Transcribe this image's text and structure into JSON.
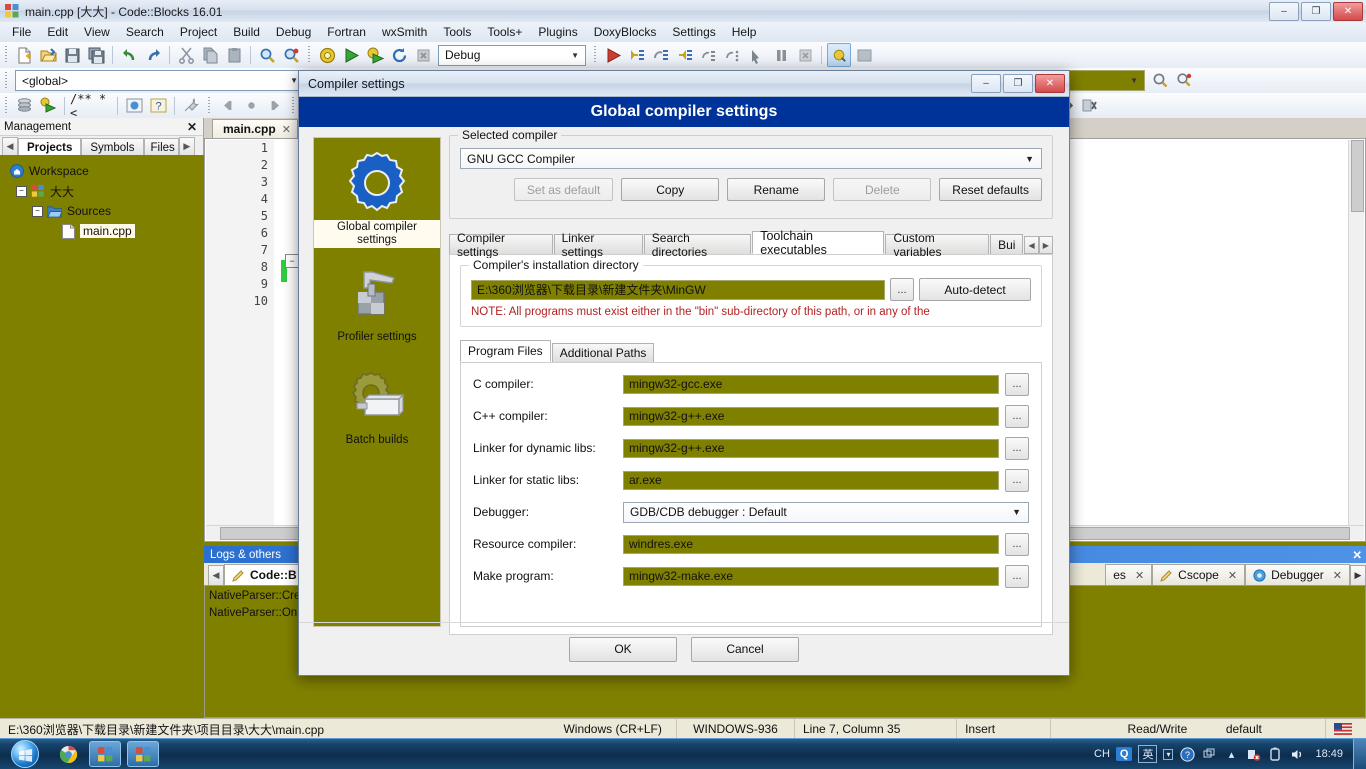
{
  "window": {
    "title": "main.cpp [大大] - Code::Blocks 16.01",
    "minimize": "–",
    "maximize": "❐",
    "close": "✕"
  },
  "menubar": {
    "items": [
      "File",
      "Edit",
      "View",
      "Search",
      "Project",
      "Build",
      "Debug",
      "Fortran",
      "wxSmith",
      "Tools",
      "Tools+",
      "Plugins",
      "DoxyBlocks",
      "Settings",
      "Help"
    ]
  },
  "toolbar": {
    "target_value": "Debug",
    "target_arrow": "▼",
    "scope_value": "<global>",
    "scope_arrow": "▼",
    "icons_row1": [
      "new-file-icon",
      "open-file-icon",
      "save-icon",
      "save-all-icon",
      "undo-icon",
      "redo-icon",
      "cut-icon",
      "copy-icon",
      "paste-icon",
      "find-icon",
      "replace-icon",
      "build-icon",
      "run-icon",
      "build-and-run-icon",
      "rebuild-icon",
      "abort-icon"
    ],
    "icons_row1b": [
      "debug-run-icon",
      "step-into-icon",
      "step-over-icon",
      "step-out-icon",
      "next-instruction-icon",
      "step-instruction-icon",
      "run-to-cursor-icon",
      "break-icon",
      "stop-debug-icon",
      "debug-windows-icon",
      "debug-info-icon"
    ],
    "icons_row3": [
      "symbols-icon",
      "build-targets-icon",
      "comment-icon",
      "doxyblocks-icon",
      "help-icon",
      "wrench-icon",
      "back-icon",
      "bookmark-icon",
      "forward-icon",
      "extra-icon"
    ],
    "icons_right": [
      "goto-declaration-icon",
      "goto-implementation-icon",
      "find-icon-2",
      "search-icon-2"
    ]
  },
  "management": {
    "title": "Management",
    "close": "✕",
    "nav_prev": "◀",
    "nav_next": "▶",
    "tabs": [
      "Projects",
      "Symbols",
      "Files"
    ],
    "selected_tab": "Projects",
    "tree": {
      "workspace": "Workspace",
      "project": "大大",
      "folder": "Sources",
      "file": "main.cpp",
      "expander_minus": "−"
    }
  },
  "editor": {
    "tab_label": "main.cpp",
    "tab_close": "✕",
    "line_numbers": [
      "1",
      "2",
      "3",
      "4",
      "5",
      "6",
      "7",
      "8",
      "9",
      "10"
    ]
  },
  "logs": {
    "title": "Logs & others",
    "close": "✕",
    "nav_prev": "◀",
    "nav_next": "▶",
    "tabs": [
      {
        "label": "Code::B",
        "icon": "pencil-icon",
        "close": "✕",
        "selected": true
      },
      {
        "label": "es",
        "icon": "",
        "close": "✕",
        "selected": false
      },
      {
        "label": "Cscope",
        "icon": "pencil-icon",
        "close": "✕",
        "selected": false
      },
      {
        "label": "Debugger",
        "icon": "debugger-icon",
        "close": "✕",
        "selected": false
      }
    ],
    "lines": [
      "NativeParser::Cre",
      "NativeParser::On"
    ]
  },
  "statusbar": {
    "path": "E:\\360浏览器\\下载目录\\新建文件夹\\项目目录\\大大\\main.cpp",
    "eol": "Windows (CR+LF)",
    "encoding": "WINDOWS-936",
    "caret": "Line 7, Column 35",
    "insert_mode": "Insert",
    "access": "Read/Write",
    "profile": "default",
    "flag_icon": "us-flag-icon"
  },
  "taskbar": {
    "start": "start-orb-icon",
    "apps": [
      "chrome-icon",
      "codeblocks-doc-icon",
      "codeblocks-icon"
    ],
    "tray": {
      "ime_lang": "CH",
      "qq": "Q",
      "ime_mode": "英",
      "ime_arrow": "▾",
      "help": "?",
      "expand": "▴",
      "icons": [
        "network-error-icon",
        "power-icon",
        "volume-icon"
      ],
      "clock": "18:49"
    }
  },
  "dialog": {
    "title": "Compiler settings",
    "banner": "Global compiler settings",
    "minimize": "–",
    "maximize": "❐",
    "close": "✕",
    "sidebar": [
      {
        "label": "Global compiler settings",
        "icon": "gear-icon",
        "selected": true
      },
      {
        "label": "Profiler settings",
        "icon": "caliper-icon",
        "selected": false
      },
      {
        "label": "Batch builds",
        "icon": "batch-builds-icon",
        "selected": false
      }
    ],
    "selected_compiler": {
      "legend": "Selected compiler",
      "value": "GNU GCC Compiler",
      "arrow": "▼",
      "buttons": [
        {
          "label": "Set as default",
          "disabled": true
        },
        {
          "label": "Copy",
          "disabled": false
        },
        {
          "label": "Rename",
          "disabled": false
        },
        {
          "label": "Delete",
          "disabled": true
        },
        {
          "label": "Reset defaults",
          "disabled": false
        }
      ]
    },
    "tabs": [
      "Compiler settings",
      "Linker settings",
      "Search directories",
      "Toolchain executables",
      "Custom variables",
      "Bui"
    ],
    "selected_tab": "Toolchain executables",
    "tab_nav_prev": "◀",
    "tab_nav_next": "▶",
    "install_dir": {
      "legend": "Compiler's installation directory",
      "value": "E:\\360浏览器\\下载目录\\新建文件夹\\MinGW",
      "browse": "...",
      "auto_detect": "Auto-detect",
      "note": "NOTE: All programs must exist either in the \"bin\" sub-directory of this path, or in any of the"
    },
    "inner_tabs": [
      "Program Files",
      "Additional Paths"
    ],
    "selected_inner_tab": "Program Files",
    "fields": [
      {
        "label": "C compiler:",
        "value": "mingw32-gcc.exe",
        "type": "text",
        "browse": "..."
      },
      {
        "label": "C++ compiler:",
        "value": "mingw32-g++.exe",
        "type": "text",
        "browse": "..."
      },
      {
        "label": "Linker for dynamic libs:",
        "value": "mingw32-g++.exe",
        "type": "text",
        "browse": "..."
      },
      {
        "label": "Linker for static libs:",
        "value": "ar.exe",
        "type": "text",
        "browse": "..."
      },
      {
        "label": "Debugger:",
        "value": "GDB/CDB debugger : Default",
        "type": "combo",
        "arrow": "▼"
      },
      {
        "label": "Resource compiler:",
        "value": "windres.exe",
        "type": "text",
        "browse": "..."
      },
      {
        "label": "Make program:",
        "value": "mingw32-make.exe",
        "type": "text",
        "browse": "..."
      }
    ],
    "ok": "OK",
    "cancel": "Cancel"
  },
  "colors": {
    "olive": "#808000",
    "banner_blue": "#003399",
    "note_red": "#b22222"
  }
}
